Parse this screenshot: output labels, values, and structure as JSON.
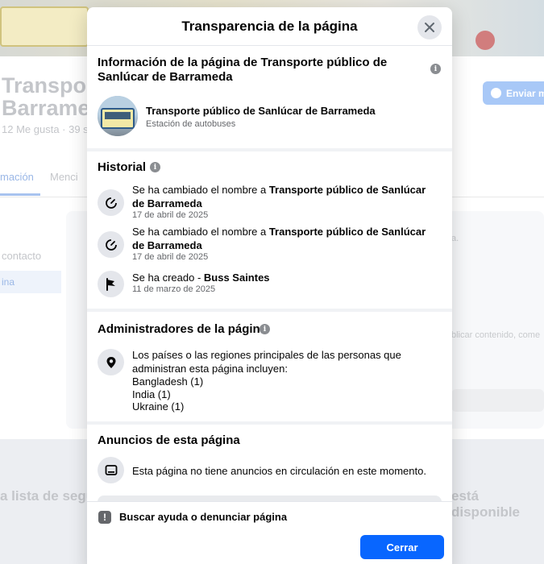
{
  "background": {
    "page_title_line1": "Transpor",
    "page_title_line2": "Barrame",
    "stats": "12 Me gusta · 39 s",
    "send_button": "Enviar m",
    "tab_active": "mación",
    "tab_other": "Menci",
    "sidebar_contact": "contacto",
    "sidebar_active": "ina",
    "card_text_1": "a.",
    "card_text_2": "blicar contenido, come",
    "list_text": "a lista de segui",
    "available_text": "está disponible"
  },
  "modal": {
    "title": "Transparencia de la página",
    "info_section": {
      "title": "Información de la página de Transporte público de Sanlúcar de Barrameda",
      "page_name": "Transporte público de Sanlúcar de Barrameda",
      "page_category": "Estación de autobuses"
    },
    "history": {
      "title": "Historial",
      "items": [
        {
          "prefix": "Se ha cambiado el nombre a ",
          "name": "Transporte público de Sanlúcar de Barrameda",
          "date": "17 de abril de 2025",
          "icon": "rename-icon"
        },
        {
          "prefix": "Se ha cambiado el nombre a ",
          "name": "Transporte público de Sanlúcar de Barrameda",
          "date": "17 de abril de 2025",
          "icon": "rename-icon"
        },
        {
          "prefix": "Se ha creado - ",
          "name": "Buss Saintes",
          "date": "11 de marzo de 2025",
          "icon": "flag-icon"
        }
      ]
    },
    "admins": {
      "title": "Administradores de la página",
      "description": "Los países o las regiones principales de las personas que administran esta página incluyen:",
      "countries": [
        "Bangladesh (1)",
        "India (1)",
        "Ukraine (1)"
      ]
    },
    "ads": {
      "title": "Anuncios de esta página",
      "text": "Esta página no tiene anuncios en circulación en este momento."
    },
    "footer": {
      "help_label": "Buscar ayuda o denunciar página",
      "close_label": "Cerrar"
    }
  },
  "colors": {
    "primary_button": "#0866ff",
    "icon_bg": "#e4e6eb",
    "secondary_text": "#65676b"
  }
}
